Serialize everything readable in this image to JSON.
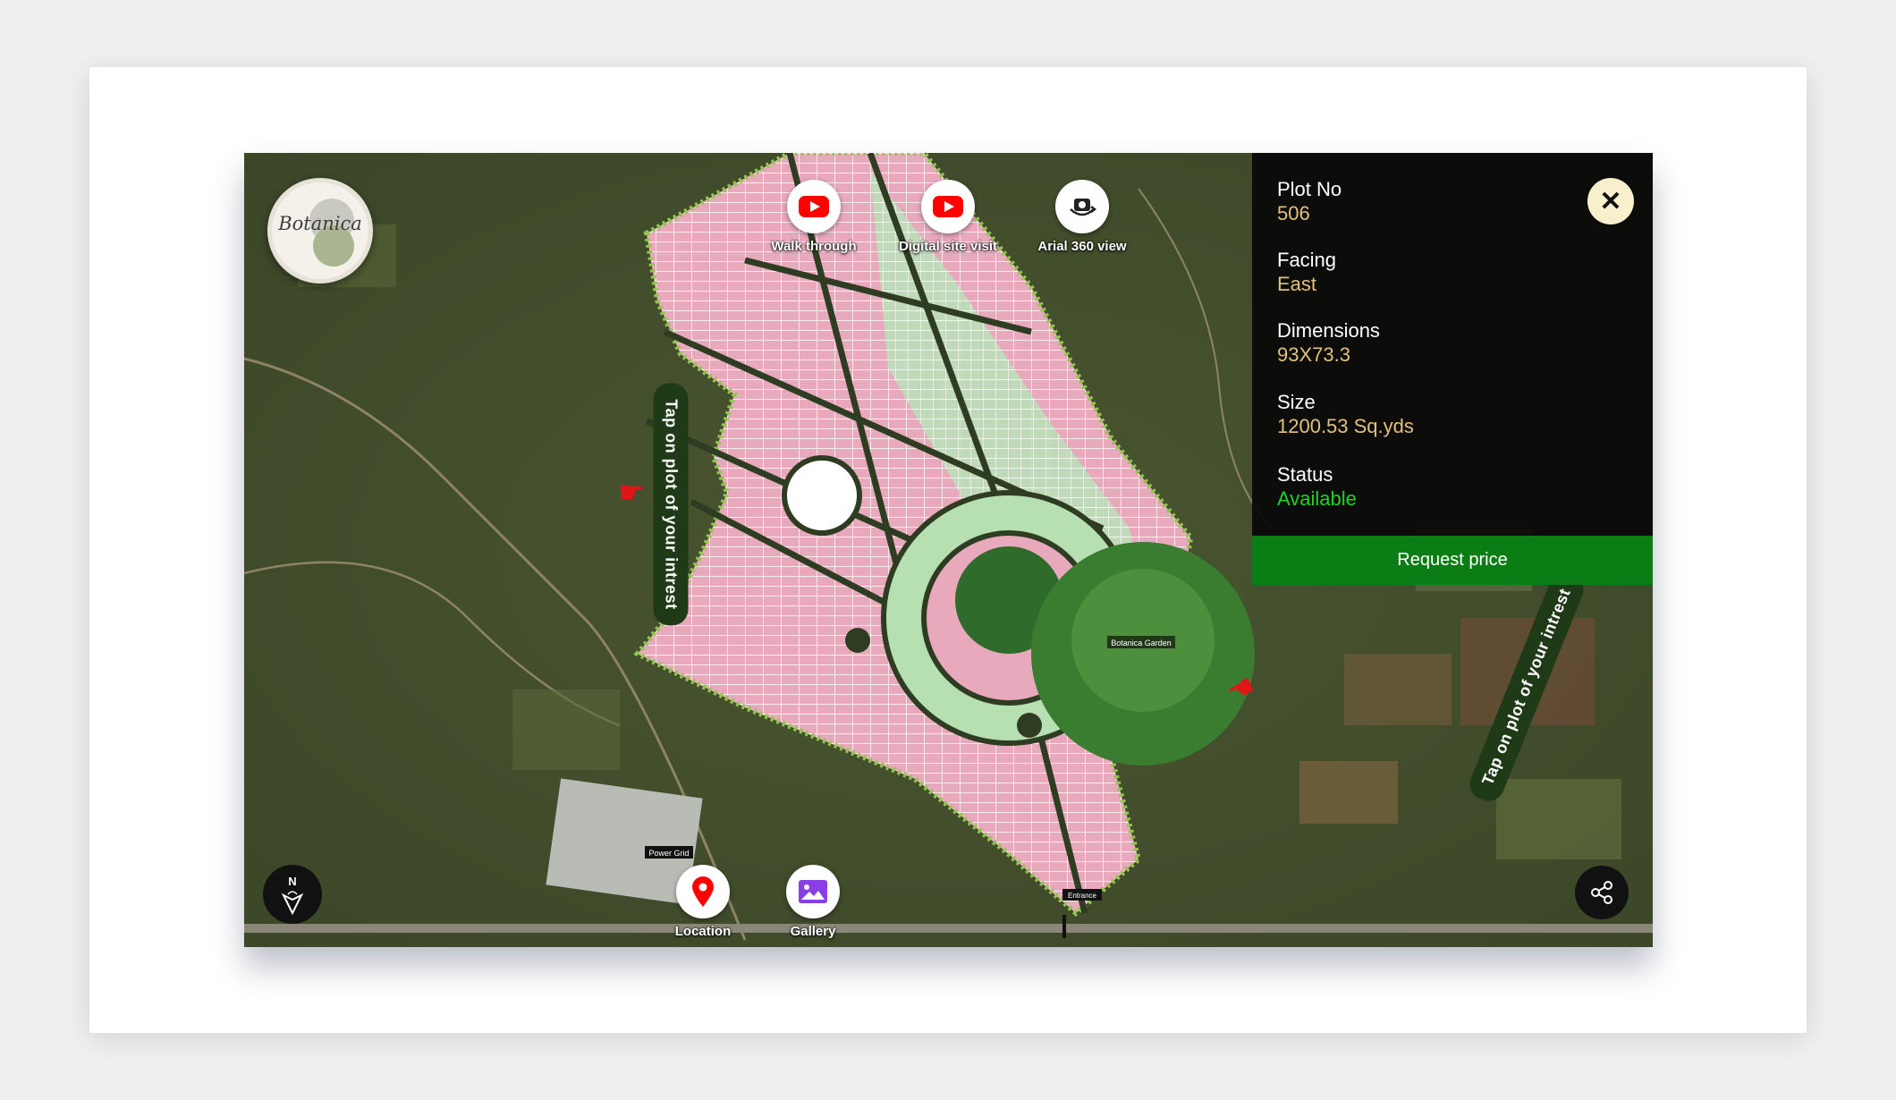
{
  "logo": {
    "text": "Botanica"
  },
  "top_buttons": [
    {
      "label": "Walk through",
      "icon": "youtube-icon"
    },
    {
      "label": "Digital site visit",
      "icon": "youtube-icon"
    },
    {
      "label": "Arial 360 view",
      "icon": "360-camera-icon"
    }
  ],
  "hints": {
    "tap_left": "Tap on plot of your intrest",
    "tap_right": "Tap on plot of your intrest"
  },
  "map_labels": {
    "garden": "Botanica Garden",
    "power_grid": "Power Grid",
    "entrance": "Entrance"
  },
  "bottom_buttons": [
    {
      "label": "Location",
      "icon": "location-pin-icon"
    },
    {
      "label": "Gallery",
      "icon": "gallery-icon"
    }
  ],
  "compass": {
    "north": "N"
  },
  "details": {
    "plot_no_label": "Plot No",
    "plot_no": "506",
    "facing_label": "Facing",
    "facing": "East",
    "dimensions_label": "Dimensions",
    "dimensions": "93X73.3",
    "size_label": "Size",
    "size": "1200.53 Sq.yds",
    "status_label": "Status",
    "status": "Available"
  },
  "request_label": "Request price",
  "colors": {
    "available": "#1fd31f",
    "value": "#e3c17b",
    "request": "#0a7d14",
    "youtube": "#ff0000",
    "gallery": "#8a3ee6"
  }
}
